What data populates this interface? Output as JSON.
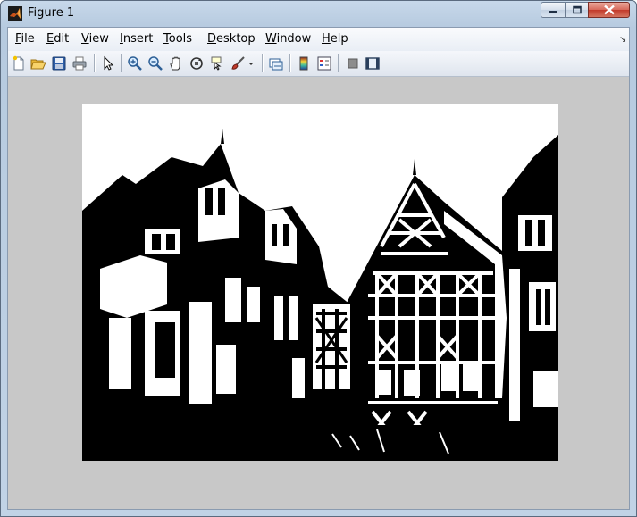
{
  "window": {
    "title": "Figure 1",
    "controls": {
      "minimize": "minimize",
      "maximize": "maximize",
      "close": "close"
    }
  },
  "menubar": {
    "items": [
      {
        "mnemonic": "F",
        "rest": "ile"
      },
      {
        "mnemonic": "E",
        "rest": "dit"
      },
      {
        "mnemonic": "V",
        "rest": "iew"
      },
      {
        "mnemonic": "I",
        "rest": "nsert"
      },
      {
        "mnemonic": "T",
        "rest": "ools"
      },
      {
        "mnemonic": "D",
        "rest": "esktop"
      },
      {
        "mnemonic": "W",
        "rest": "indow"
      },
      {
        "mnemonic": "H",
        "rest": "elp"
      }
    ],
    "overflow_icon": "arrow-down-right-icon"
  },
  "toolbar": {
    "buttons": [
      "new-figure-icon",
      "open-file-icon",
      "save-icon",
      "print-icon",
      "edit-plot-arrow-icon",
      "zoom-in-icon",
      "zoom-out-icon",
      "pan-hand-icon",
      "rotate-3d-icon",
      "data-cursor-icon",
      "brush-icon",
      "brush-dropdown-icon",
      "link-plot-icon",
      "insert-colorbar-icon",
      "insert-legend-icon",
      "hide-plot-tools-icon",
      "show-plot-tools-icon"
    ]
  },
  "figure": {
    "image": "binary black-and-white photo of half-timbered houses",
    "colors": {
      "background": "#c8c8c8",
      "image_foreground": "#000000",
      "image_background": "#ffffff"
    }
  }
}
